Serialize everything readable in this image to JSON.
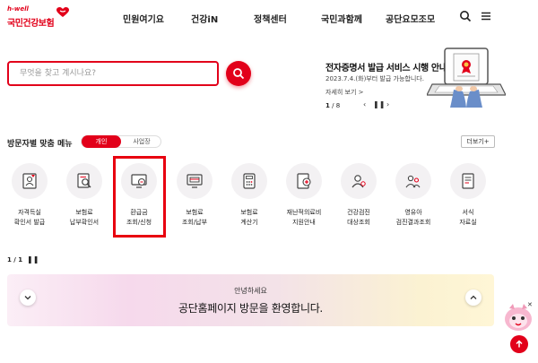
{
  "header": {
    "logo_tagline": "h-well",
    "logo_name": "국민건강보험",
    "nav": [
      "민원여기요",
      "건강iN",
      "정책센터",
      "국민과함께",
      "공단요모조모"
    ],
    "icons": [
      "search-icon",
      "menu-icon"
    ]
  },
  "search": {
    "placeholder": "무엇을 찾고 계시나요?"
  },
  "banner": {
    "title": "전자증명서 발급 서비스 시행 안내",
    "subtitle": "2023.7.4.(화)부터 발급 가능합니다.",
    "more": "자세히 보기 >",
    "page_current": "1",
    "page_total": "/ 8"
  },
  "visitor_menu": {
    "heading": "방문자별 맞춤 메뉴",
    "tab_active": "개인",
    "tab_inactive": "사업장",
    "more_button": "더보기+",
    "items": [
      {
        "line1": "자격득실",
        "line2": "확인서 발급",
        "icon": "id-card-icon"
      },
      {
        "line1": "보험료",
        "line2": "납부확인서",
        "icon": "search-document-icon"
      },
      {
        "line1": "환급금",
        "line2": "조회/신청",
        "icon": "refund-monitor-icon"
      },
      {
        "line1": "보험료",
        "line2": "조회/납부",
        "icon": "payment-monitor-icon"
      },
      {
        "line1": "보험료",
        "line2": "계산기",
        "icon": "calculator-icon"
      },
      {
        "line1": "재난적의료비",
        "line2": "지원안내",
        "icon": "medical-cost-icon"
      },
      {
        "line1": "건강검진",
        "line2": "대상조회",
        "icon": "person-search-icon"
      },
      {
        "line1": "영유아",
        "line2": "검진결과조회",
        "icon": "family-icon"
      },
      {
        "line1": "서식",
        "line2": "자료실",
        "icon": "form-document-icon"
      }
    ]
  },
  "notice": {
    "pager": "1 / 1",
    "hello": "안녕하세요",
    "message": "공단홈페이지 방문을 환영합니다."
  },
  "colors": {
    "brand": "#e2001a",
    "highlight_box": "#e8000f"
  }
}
